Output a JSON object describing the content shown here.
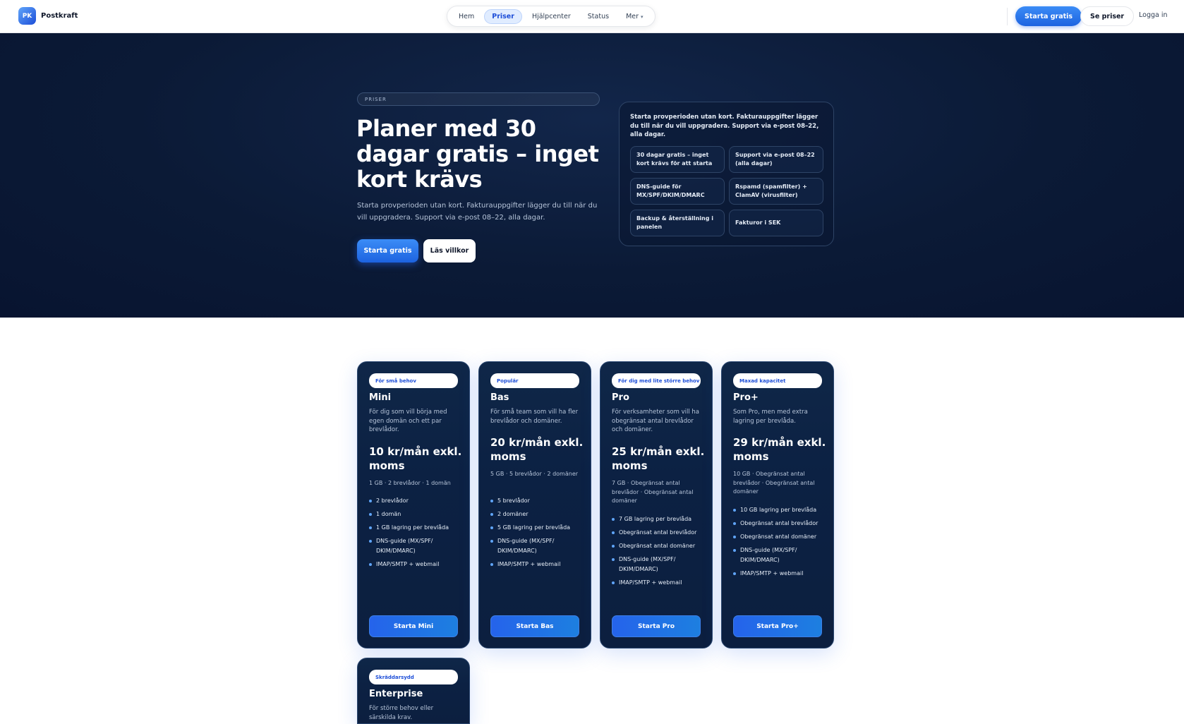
{
  "brand": {
    "logo_text": "PK",
    "name": "Postkraft"
  },
  "nav": {
    "items": [
      {
        "label": "Hem"
      },
      {
        "label": "Priser"
      },
      {
        "label": "Hjälpcenter"
      },
      {
        "label": "Status"
      },
      {
        "label": "Mer"
      }
    ],
    "active": "Priser"
  },
  "header_actions": {
    "primary_label": "Starta gratis",
    "secondary_label": "Se priser",
    "login_label": "Logga in"
  },
  "hero": {
    "eyebrow": "PRISER",
    "title": "Planer med 30 dagar gratis – inget kort krävs",
    "lead": "Starta provperioden utan kort. Fakturauppgifter lägger du till när du vill uppgradera. Support via e-post 08–22, alla dagar.",
    "primary_label": "Starta gratis",
    "secondary_label": "Läs villkor",
    "panel_text": "Starta provperioden utan kort. Fakturauppgifter lägger du till när du vill uppgradera. Support via e-post 08–22, alla dagar.",
    "features": [
      "30 dagar gratis – inget kort krävs för att starta",
      "Support via e-post 08–22 (alla dagar)",
      "DNS-guide för MX/SPF/DKIM/DMARC",
      "Rspamd (spamfilter) + ClamAV (virusfilter)",
      "Backup & återställning i panelen",
      "Fakturor i SEK"
    ]
  },
  "plans": [
    {
      "badge": "För små behov",
      "name": "Mini",
      "desc": "För dig som vill börja med egen domän och ett par brevlådor.",
      "price": "10 kr/mån exkl. moms",
      "quota": "1 GB · 2 brevlådor · 1 domän",
      "features": [
        "2 brevlådor",
        "1 domän",
        "1 GB lagring per brevlåda",
        "DNS-guide (MX/SPF/ DKIM/DMARC)",
        "IMAP/SMTP + webmail"
      ],
      "cta": "Starta Mini"
    },
    {
      "badge": "Populär",
      "name": "Bas",
      "desc": "För små team som vill ha fler brevlådor och domäner.",
      "price": "20 kr/mån exkl. moms",
      "quota": "5 GB · 5 brevlådor · 2 domäner",
      "features": [
        "5 brevlådor",
        "2 domäner",
        "5 GB lagring per brevlåda",
        "DNS-guide (MX/SPF/ DKIM/DMARC)",
        "IMAP/SMTP + webmail"
      ],
      "cta": "Starta Bas"
    },
    {
      "badge": "För dig med lite större behov",
      "name": "Pro",
      "desc": "För verksamheter som vill ha obegränsat antal brevlådor och domäner.",
      "price": "25 kr/mån exkl. moms",
      "quota": "7 GB · Obegränsat antal brevlådor · Obegränsat antal domäner",
      "features": [
        "7 GB lagring per brevlåda",
        "Obegränsat antal brevlådor",
        "Obegränsat antal domäner",
        "DNS-guide (MX/SPF/ DKIM/DMARC)",
        "IMAP/SMTP + webmail"
      ],
      "cta": "Starta Pro"
    },
    {
      "badge": "Maxad kapacitet",
      "name": "Pro+",
      "desc": "Som Pro, men med extra lagring per brevlåda.",
      "price": "29 kr/mån exkl. moms",
      "quota": "10 GB · Obegränsat antal brevlådor · Obegränsat antal domäner",
      "features": [
        "10 GB lagring per brevlåda",
        "Obegränsat antal brevlådor",
        "Obegränsat antal domäner",
        "DNS-guide (MX/SPF/ DKIM/DMARC)",
        "IMAP/SMTP + webmail"
      ],
      "cta": "Starta Pro+"
    },
    {
      "badge": "Skräddarsydd",
      "name": "Enterprise",
      "desc": "För större behov eller särskilda krav."
    }
  ],
  "colors": {
    "accent": "#2563eb",
    "hero_bg": "#0b1a36",
    "card_bg": "#0c2143"
  }
}
